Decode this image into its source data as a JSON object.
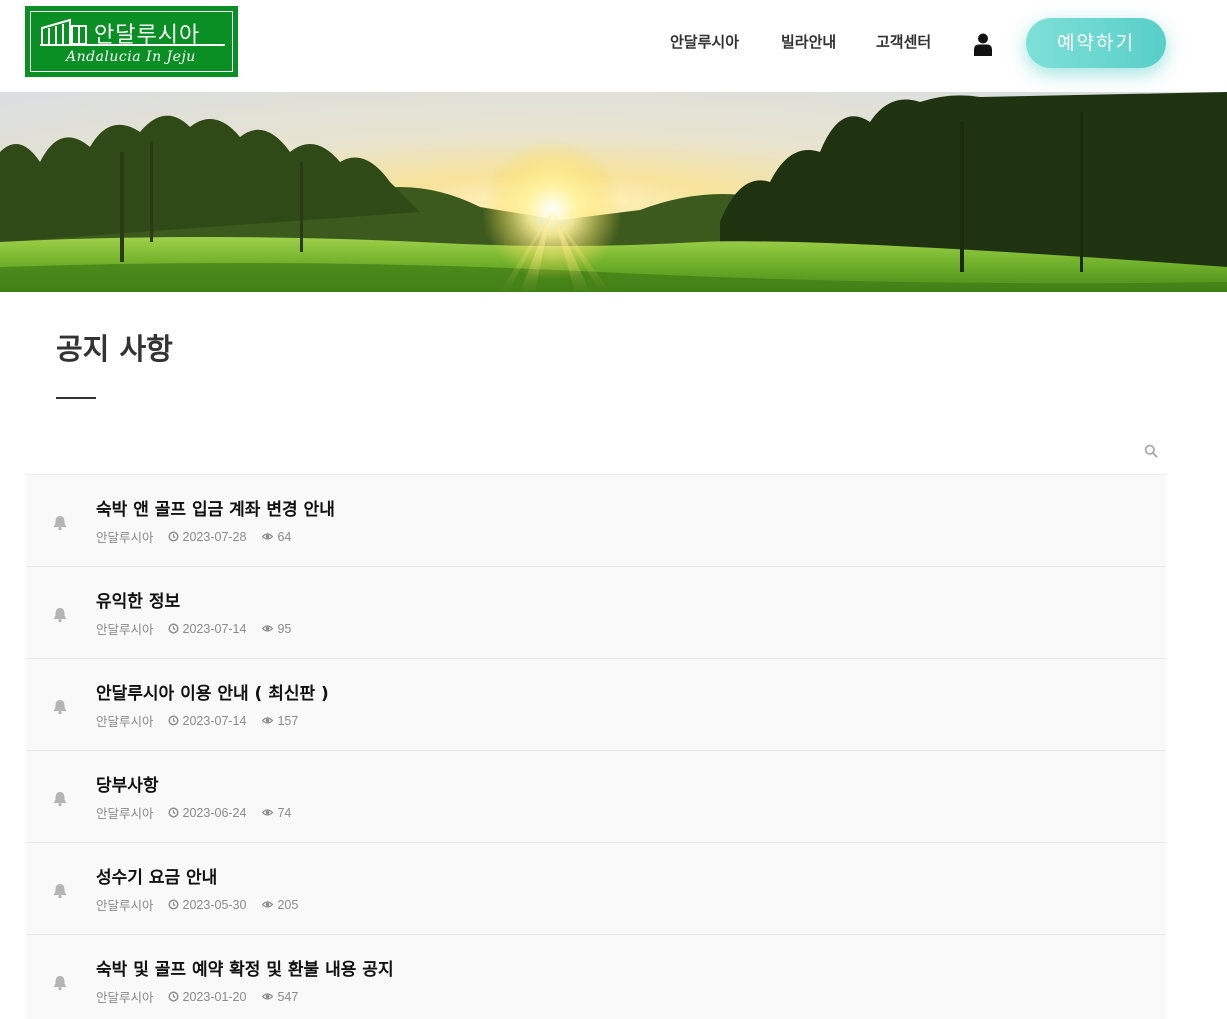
{
  "brand": {
    "name": "안달루시아",
    "subtitle": "Andalucia In Jeju",
    "logo_color": "#0a8f24"
  },
  "nav": {
    "items": [
      {
        "label": "안달루시아"
      },
      {
        "label": "빌라안내"
      },
      {
        "label": "고객센터"
      }
    ],
    "user_icon": "user-icon",
    "reserve_label": "예약하기",
    "reserve_color": "#62d3cb"
  },
  "page": {
    "title": "공지 사항"
  },
  "search": {
    "icon": "search-icon"
  },
  "notices": [
    {
      "title": "숙박 앤 골프 입금 계좌 변경 안내",
      "author": "안달루시아",
      "date": "2023-07-28",
      "views": "64"
    },
    {
      "title": "유익한 정보",
      "author": "안달루시아",
      "date": "2023-07-14",
      "views": "95"
    },
    {
      "title": "안달루시아 이용 안내 ( 최신판 )",
      "author": "안달루시아",
      "date": "2023-07-14",
      "views": "157"
    },
    {
      "title": "당부사항",
      "author": "안달루시아",
      "date": "2023-06-24",
      "views": "74"
    },
    {
      "title": "성수기 요금 안내",
      "author": "안달루시아",
      "date": "2023-05-30",
      "views": "205"
    },
    {
      "title": "숙박 및 골프 예약 확정 및 환불 내용 공지",
      "author": "안달루시아",
      "date": "2023-01-20",
      "views": "547"
    }
  ]
}
